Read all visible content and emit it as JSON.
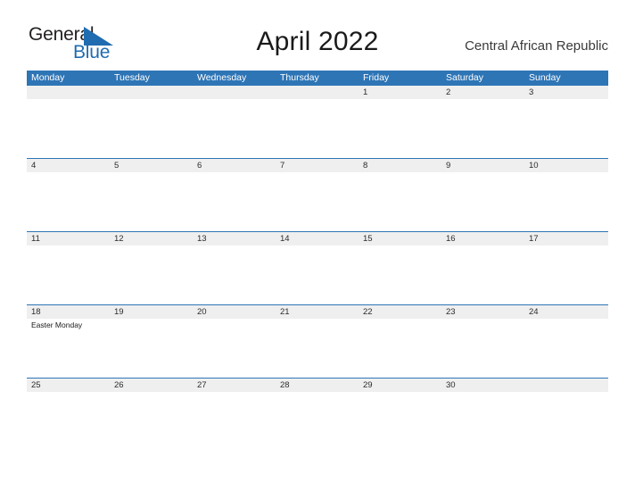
{
  "brand": {
    "name_part1": "General",
    "name_part2": "Blue",
    "flag_icon": "blue-triangle-flag-icon",
    "accent_color": "#1f6cb0"
  },
  "header": {
    "title": "April 2022",
    "country": "Central African Republic"
  },
  "theme": {
    "header_band": "#2e75b6",
    "date_band": "#efefef",
    "grid_line": "#2e75b6",
    "text": "#2b2b2b",
    "page_background": "#ffffff"
  },
  "calendar": {
    "day_names": [
      "Monday",
      "Tuesday",
      "Wednesday",
      "Thursday",
      "Friday",
      "Saturday",
      "Sunday"
    ],
    "weeks": [
      {
        "days": [
          {
            "date": "",
            "events": []
          },
          {
            "date": "",
            "events": []
          },
          {
            "date": "",
            "events": []
          },
          {
            "date": "",
            "events": []
          },
          {
            "date": "1",
            "events": []
          },
          {
            "date": "2",
            "events": []
          },
          {
            "date": "3",
            "events": []
          }
        ]
      },
      {
        "days": [
          {
            "date": "4",
            "events": []
          },
          {
            "date": "5",
            "events": []
          },
          {
            "date": "6",
            "events": []
          },
          {
            "date": "7",
            "events": []
          },
          {
            "date": "8",
            "events": []
          },
          {
            "date": "9",
            "events": []
          },
          {
            "date": "10",
            "events": []
          }
        ]
      },
      {
        "days": [
          {
            "date": "11",
            "events": []
          },
          {
            "date": "12",
            "events": []
          },
          {
            "date": "13",
            "events": []
          },
          {
            "date": "14",
            "events": []
          },
          {
            "date": "15",
            "events": []
          },
          {
            "date": "16",
            "events": []
          },
          {
            "date": "17",
            "events": []
          }
        ]
      },
      {
        "days": [
          {
            "date": "18",
            "events": [
              "Easter Monday"
            ]
          },
          {
            "date": "19",
            "events": []
          },
          {
            "date": "20",
            "events": []
          },
          {
            "date": "21",
            "events": []
          },
          {
            "date": "22",
            "events": []
          },
          {
            "date": "23",
            "events": []
          },
          {
            "date": "24",
            "events": []
          }
        ]
      },
      {
        "days": [
          {
            "date": "25",
            "events": []
          },
          {
            "date": "26",
            "events": []
          },
          {
            "date": "27",
            "events": []
          },
          {
            "date": "28",
            "events": []
          },
          {
            "date": "29",
            "events": []
          },
          {
            "date": "30",
            "events": []
          },
          {
            "date": "",
            "events": []
          }
        ]
      }
    ]
  }
}
